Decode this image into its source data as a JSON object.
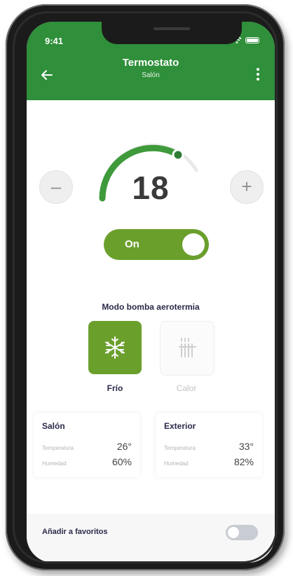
{
  "status": {
    "time": "9:41"
  },
  "header": {
    "title": "Termostato",
    "subtitle": "Salón"
  },
  "thermostat": {
    "temperature": "18",
    "minus_label": "–",
    "plus_label": "+"
  },
  "power_toggle": {
    "label": "On",
    "state": "on"
  },
  "mode": {
    "label": "Modo bomba aerotermia",
    "options": [
      {
        "name": "Frío",
        "icon": "snowflake-icon",
        "selected": true
      },
      {
        "name": "Calor",
        "icon": "heater-icon",
        "selected": false
      }
    ]
  },
  "rooms": [
    {
      "name": "Salón",
      "temp_label": "Temperatura",
      "temp": "26°",
      "hum_label": "Humedad",
      "hum": "60%"
    },
    {
      "name": "Exterior",
      "temp_label": "Temperatura",
      "temp": "33°",
      "hum_label": "Humedad",
      "hum": "82%"
    }
  ],
  "favorites": {
    "label": "Añadir a favoritos",
    "state": "off"
  },
  "colors": {
    "header_green": "#2f8f3a",
    "accent_green": "#6a9f2c",
    "text_dark": "#2a2a4a"
  }
}
